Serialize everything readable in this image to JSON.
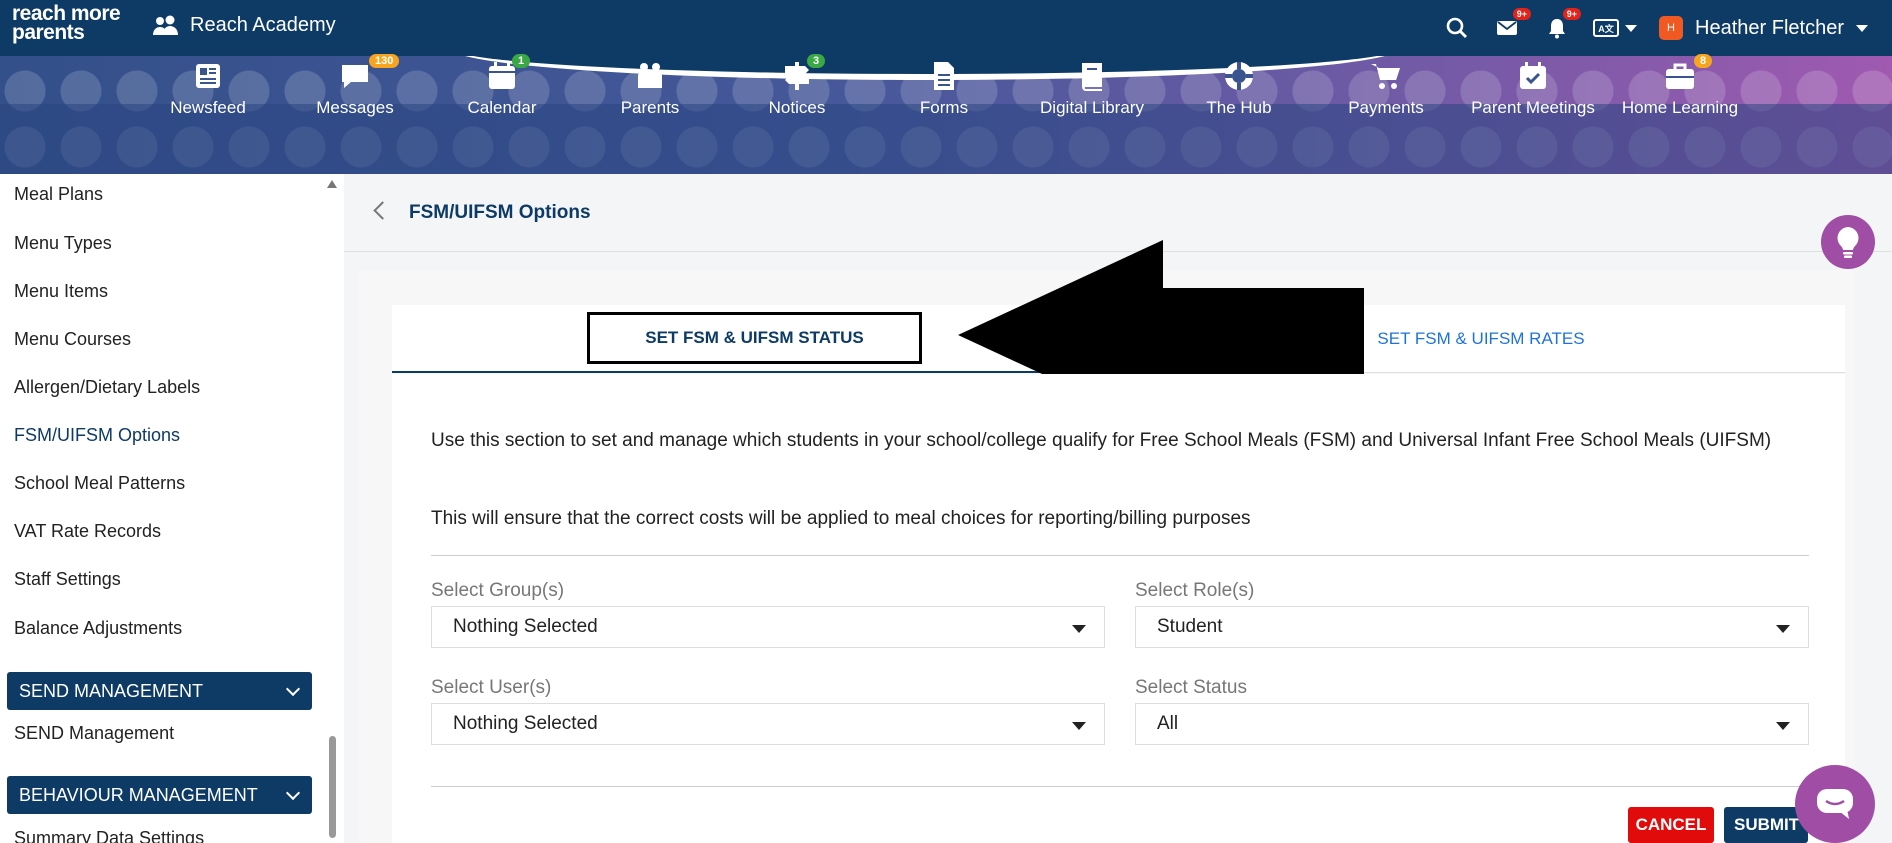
{
  "brand": {
    "logo_line1": "reach more",
    "logo_line2": "parents",
    "org_name": "Reach Academy"
  },
  "topbar": {
    "messages_badge": "9+",
    "notifications_badge": "9+",
    "language_label": "A文",
    "user_initial": "H",
    "user_name": "Heather Fletcher"
  },
  "nav": {
    "items": [
      {
        "label": "Newsfeed",
        "badge": ""
      },
      {
        "label": "Messages",
        "badge": "130"
      },
      {
        "label": "Calendar",
        "badge": "1"
      },
      {
        "label": "Parents",
        "badge": ""
      },
      {
        "label": "Notices",
        "badge": "3"
      },
      {
        "label": "Forms",
        "badge": ""
      },
      {
        "label": "Digital Library",
        "badge": ""
      },
      {
        "label": "The Hub",
        "badge": ""
      },
      {
        "label": "Payments",
        "badge": ""
      },
      {
        "label": "Parent Meetings",
        "badge": ""
      },
      {
        "label": "Home Learning",
        "badge": "8"
      }
    ]
  },
  "sidebar": {
    "items": [
      "Meal Plans",
      "Menu Types",
      "Menu Items",
      "Menu Courses",
      "Allergen/Dietary Labels",
      "FSM/UIFSM Options",
      "School Meal Patterns",
      "VAT Rate Records",
      "Staff Settings",
      "Balance Adjustments"
    ],
    "active_item": "FSM/UIFSM Options",
    "section1_title": "SEND MANAGEMENT",
    "section1_items": [
      "SEND Management"
    ],
    "section2_title": "BEHAVIOUR MANAGEMENT",
    "section2_items": [
      "Summary Data Settings"
    ]
  },
  "page": {
    "title": "FSM/UIFSM Options",
    "tabs": [
      {
        "label": "SET FSM & UIFSM STATUS",
        "active": true
      },
      {
        "label": "SET FSM & UIFSM RATES",
        "active": false
      }
    ],
    "description": "Use this section to set and manage which students in your school/college qualify for Free School Meals (FSM) and Universal Infant Free School Meals (UIFSM)",
    "description2": "This will ensure that the correct costs will be applied to meal choices for reporting/billing purposes",
    "fields": {
      "group_label": "Select Group(s)",
      "group_value": "Nothing Selected",
      "role_label": "Select Role(s)",
      "role_value": "Student",
      "user_label": "Select User(s)",
      "user_value": "Nothing Selected",
      "status_label": "Select Status",
      "status_value": "All"
    },
    "cancel_label": "CANCEL",
    "submit_label": "SUBMIT"
  },
  "colors": {
    "primary": "#0d3b66",
    "accent_link": "#1e73d8",
    "cancel": "#e20b0b",
    "assistant": "#a04ea5"
  }
}
